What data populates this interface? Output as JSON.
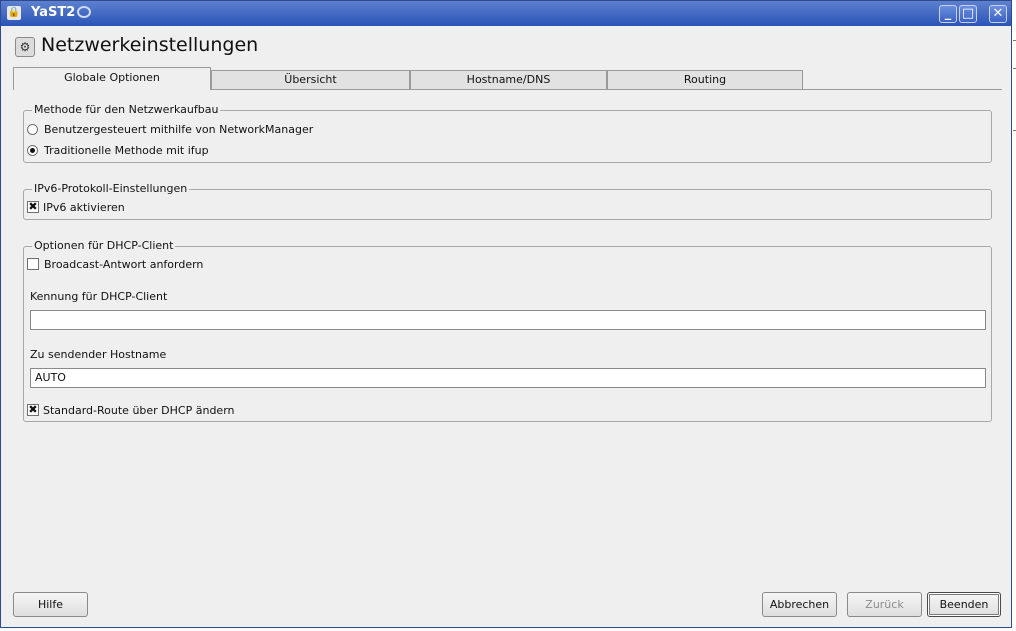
{
  "window": {
    "title": "YaST2",
    "controls": {
      "minimize": "_",
      "maximize": "□",
      "close": "✕"
    }
  },
  "page": {
    "heading": "Netzwerkeinstellungen"
  },
  "tabs": [
    {
      "label": "Globale Optionen",
      "active": true
    },
    {
      "label": "Übersicht",
      "active": false
    },
    {
      "label": "Hostname/DNS",
      "active": false
    },
    {
      "label": "Routing",
      "active": false
    }
  ],
  "groups": {
    "setup_method": {
      "legend": "Methode für den Netzwerkaufbau",
      "options": [
        {
          "label": "Benutzergesteuert mithilfe von NetworkManager",
          "selected": false
        },
        {
          "label": "Traditionelle Methode mit ifup",
          "selected": true
        }
      ]
    },
    "ipv6": {
      "legend": "IPv6-Protokoll-Einstellungen",
      "enable": {
        "label": "IPv6 aktivieren",
        "checked": true
      }
    },
    "dhcp": {
      "legend": "Optionen für DHCP-Client",
      "broadcast": {
        "label": "Broadcast-Antwort anfordern",
        "checked": false
      },
      "client_id": {
        "label": "Kennung für DHCP-Client",
        "value": ""
      },
      "hostname": {
        "label": "Zu sendender Hostname",
        "value": "AUTO"
      },
      "default_route": {
        "label": "Standard-Route über DHCP ändern",
        "checked": true
      }
    }
  },
  "buttons": {
    "help": "Hilfe",
    "cancel": "Abbrechen",
    "back": "Zurück",
    "finish": "Beenden"
  },
  "icons": {
    "check_mark": "✖",
    "app": "🔒",
    "heading": "⚙"
  }
}
